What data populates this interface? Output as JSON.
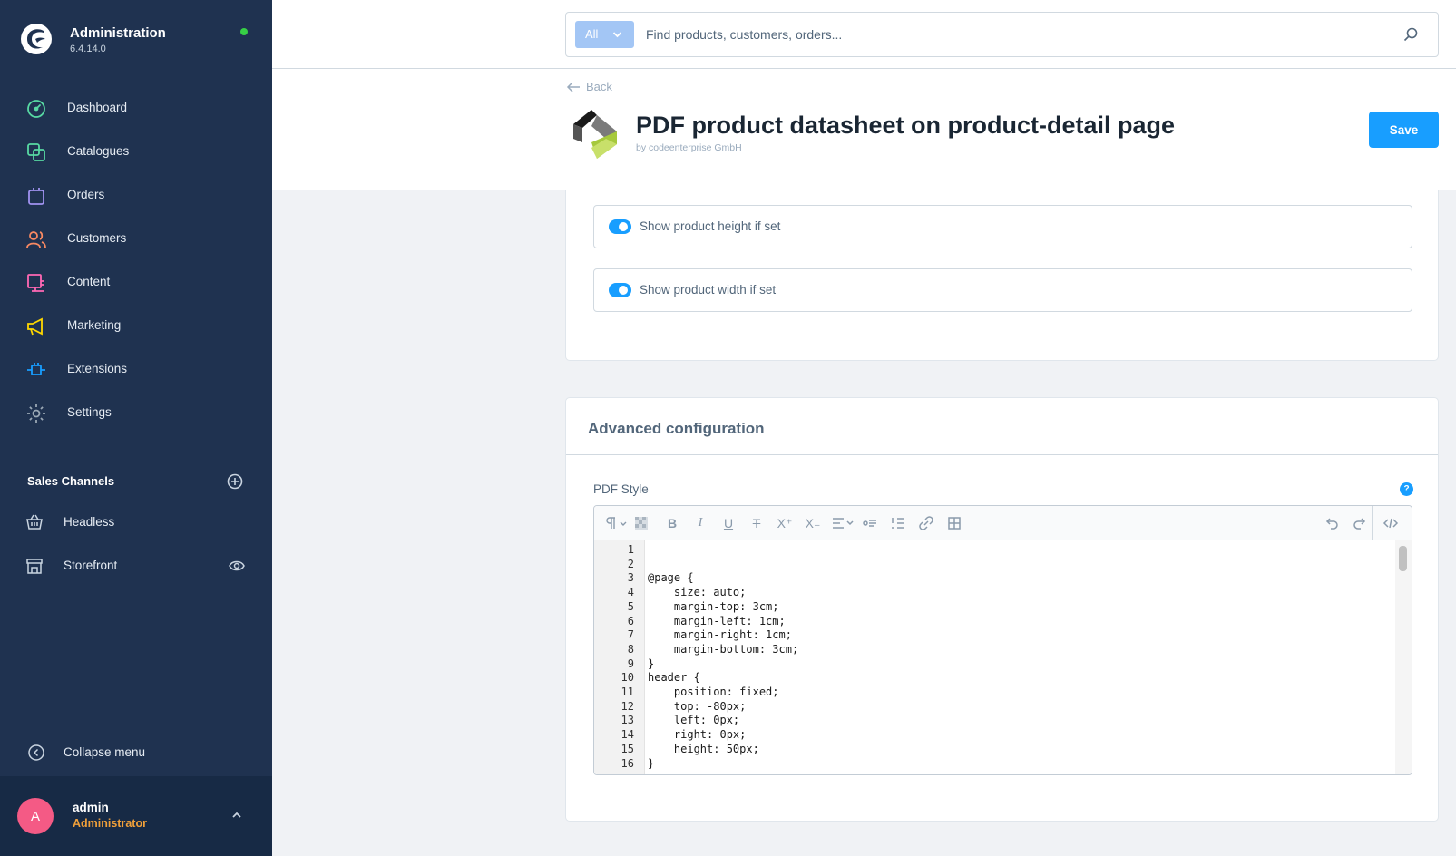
{
  "app": {
    "title": "Administration",
    "version": "6.4.14.0"
  },
  "nav": [
    {
      "label": "Dashboard",
      "icon": "dashboard-icon",
      "color": "#57d9a3"
    },
    {
      "label": "Catalogues",
      "icon": "catalogue-icon",
      "color": "#57d9a3"
    },
    {
      "label": "Orders",
      "icon": "orders-icon",
      "color": "#a092f0"
    },
    {
      "label": "Customers",
      "icon": "customers-icon",
      "color": "#f88962"
    },
    {
      "label": "Content",
      "icon": "content-icon",
      "color": "#ff68b4"
    },
    {
      "label": "Marketing",
      "icon": "marketing-icon",
      "color": "#ffd700"
    },
    {
      "label": "Extensions",
      "icon": "extensions-icon",
      "color": "#189eff"
    },
    {
      "label": "Settings",
      "icon": "settings-icon",
      "color": "#9aa8b5"
    }
  ],
  "sales_channels": {
    "title": "Sales Channels",
    "items": [
      {
        "label": "Headless"
      },
      {
        "label": "Storefront"
      }
    ]
  },
  "collapse_label": "Collapse menu",
  "user": {
    "initial": "A",
    "name": "admin",
    "role": "Administrator"
  },
  "search": {
    "scope": "All",
    "placeholder": "Find products, customers, orders..."
  },
  "page": {
    "back_label": "Back",
    "title": "PDF product datasheet on product-detail page",
    "subtitle": "by codeenterprise GmbH",
    "save_label": "Save"
  },
  "toggles": [
    {
      "label": "Show product height if set",
      "on": true
    },
    {
      "label": "Show product width if set",
      "on": true
    }
  ],
  "advanced": {
    "title": "Advanced configuration",
    "field_label": "PDF Style",
    "help": "?"
  },
  "code_lines": [
    "",
    "",
    "@page {",
    "    size: auto;",
    "    margin-top: 3cm;",
    "    margin-left: 1cm;",
    "    margin-right: 1cm;",
    "    margin-bottom: 3cm;",
    "}",
    "header {",
    "    position: fixed;",
    "    top: -80px;",
    "    left: 0px;",
    "    right: 0px;",
    "    height: 50px;",
    "}"
  ],
  "colors": {
    "sidebar": "#1f3250",
    "accent": "#189eff",
    "status_online": "#37d046",
    "avatar": "#f45a85",
    "role": "#f0a03a"
  }
}
